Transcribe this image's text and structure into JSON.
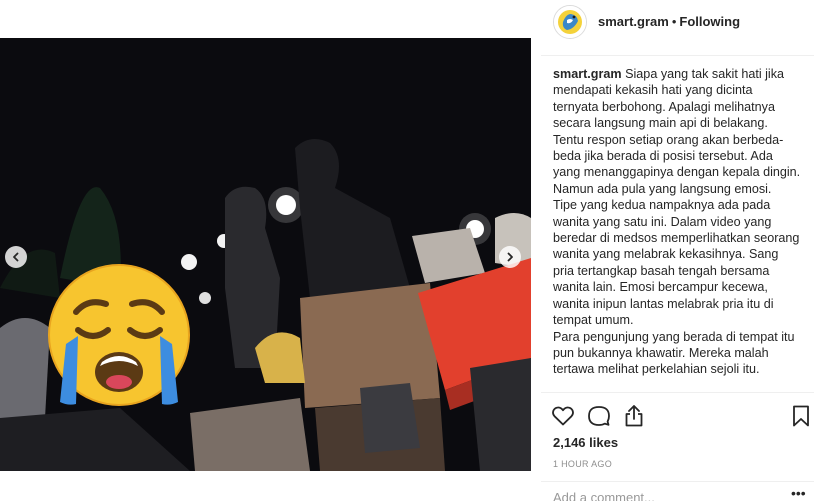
{
  "post": {
    "username": "smart.gram",
    "separator": "•",
    "follow_status": "Following",
    "caption": {
      "username": "smart.gram",
      "paragraphs": [
        "Siapa yang tak sakit hati jika mendapati kekasih hati yang dicinta ternyata berbohong. Apalagi melihatnya secara langsung main api di belakang. Tentu respon setiap orang akan berbeda-beda jika berada di posisi tersebut. Ada yang menanggapinya dengan kepala dingin. Namun ada pula yang langsung emosi.",
        "Tipe yang kedua nampaknya ada pada wanita yang satu ini. Dalam video yang beredar di medsos memperlihatkan seorang wanita yang melabrak kekasihnya. Sang pria tertangkap basah tengah bersama wanita lain. Emosi bercampur kecewa, wanita inipun lantas melabrak pria itu di tempat umum.",
        "Para pengunjung yang berada di tempat itu pun bukannya khawatir. Mereka malah tertawa melihat perkelahian sejoli itu."
      ]
    },
    "likes": "2,146 likes",
    "timestamp": "1 HOUR AGO",
    "comment_placeholder": "Add a comment...",
    "more_label": "•••"
  },
  "media": {
    "sticker": "loudly-crying-face-emoji",
    "scene": "night outdoor food stall video frame"
  },
  "icons": {
    "avatar": "smart-gram-logo",
    "like": "heart-outline-icon",
    "comment": "speech-bubble-icon",
    "share": "share-upload-icon",
    "save": "bookmark-icon",
    "prev": "chevron-left-icon",
    "next": "chevron-right-icon"
  },
  "colors": {
    "text": "#262626",
    "muted": "#8e8e8e",
    "divider": "#efefef",
    "sticker_yellow": "#f7c52f",
    "sticker_tears": "#3d8de0"
  }
}
